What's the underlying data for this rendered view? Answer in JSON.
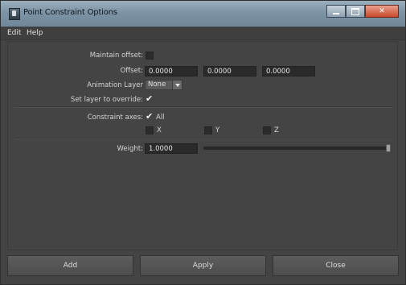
{
  "window": {
    "title": "Point Constraint Options"
  },
  "menu": {
    "items": [
      "Edit",
      "Help"
    ]
  },
  "form": {
    "maintain_offset_label": "Maintain offset:",
    "offset_label": "Offset:",
    "offset_values": [
      "0.0000",
      "0.0000",
      "0.0000"
    ],
    "animation_layer_label": "Animation Layer",
    "animation_layer_value": "None",
    "set_layer_label": "Set layer to override:",
    "constraint_axes_label": "Constraint axes:",
    "axis_all_label": "All",
    "axis_x_label": "X",
    "axis_y_label": "Y",
    "axis_z_label": "Z",
    "weight_label": "Weight:",
    "weight_value": "1.0000",
    "weight_slider_level": 1.0
  },
  "state": {
    "maintain_offset_checked": false,
    "set_layer_checked": true,
    "axis_all_checked": true,
    "axis_x_checked": false,
    "axis_y_checked": false,
    "axis_z_checked": false
  },
  "buttons": {
    "add": "Add",
    "apply": "Apply",
    "close": "Close"
  },
  "colors": {
    "panel": "#444444",
    "field": "#2a2a2a",
    "titlebar": "#7d94a6",
    "close": "#c84a2c"
  }
}
